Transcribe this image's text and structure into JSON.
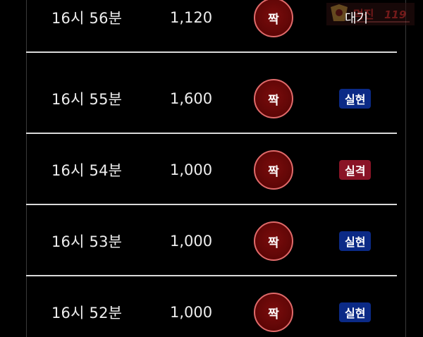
{
  "watermark": {
    "text": "먹진"
  },
  "rows": [
    {
      "time": "16시 56분",
      "amount": "1,120",
      "pick": "짝",
      "status": "대기",
      "status_type": "wait"
    },
    {
      "time": "16시 55분",
      "amount": "1,600",
      "pick": "짝",
      "status": "실현",
      "status_type": "win"
    },
    {
      "time": "16시 54분",
      "amount": "1,000",
      "pick": "짝",
      "status": "실격",
      "status_type": "lose"
    },
    {
      "time": "16시 53분",
      "amount": "1,000",
      "pick": "짝",
      "status": "실현",
      "status_type": "win"
    },
    {
      "time": "16시 52분",
      "amount": "1,000",
      "pick": "짝",
      "status": "실현",
      "status_type": "win"
    }
  ],
  "colors": {
    "background": "#000000",
    "pick_fill": "#6a0808",
    "pick_ring": "#e06a6a",
    "win_badge": "#0b2a86",
    "lose_badge": "#8a1426"
  }
}
